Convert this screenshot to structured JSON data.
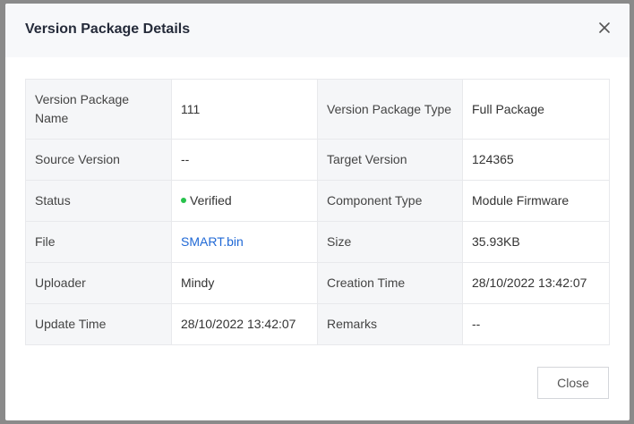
{
  "dialog": {
    "title": "Version Package Details",
    "close_button_label": "Close"
  },
  "details": {
    "version_package_name_label": "Version Package Name",
    "version_package_name_value": "111",
    "version_package_type_label": "Version Package Type",
    "version_package_type_value": "Full Package",
    "source_version_label": "Source Version",
    "source_version_value": "--",
    "target_version_label": "Target Version",
    "target_version_value": "124365",
    "status_label": "Status",
    "status_value": "Verified",
    "status_color": "#27c24c",
    "component_type_label": "Component Type",
    "component_type_value": "Module Firmware",
    "file_label": "File",
    "file_value": "SMART.bin",
    "size_label": "Size",
    "size_value": "35.93KB",
    "uploader_label": "Uploader",
    "uploader_value": "Mindy",
    "creation_time_label": "Creation Time",
    "creation_time_value": "28/10/2022 13:42:07",
    "update_time_label": "Update Time",
    "update_time_value": "28/10/2022 13:42:07",
    "remarks_label": "Remarks",
    "remarks_value": "--"
  },
  "icons": {
    "close": "close-icon",
    "status": "status-dot-icon"
  }
}
